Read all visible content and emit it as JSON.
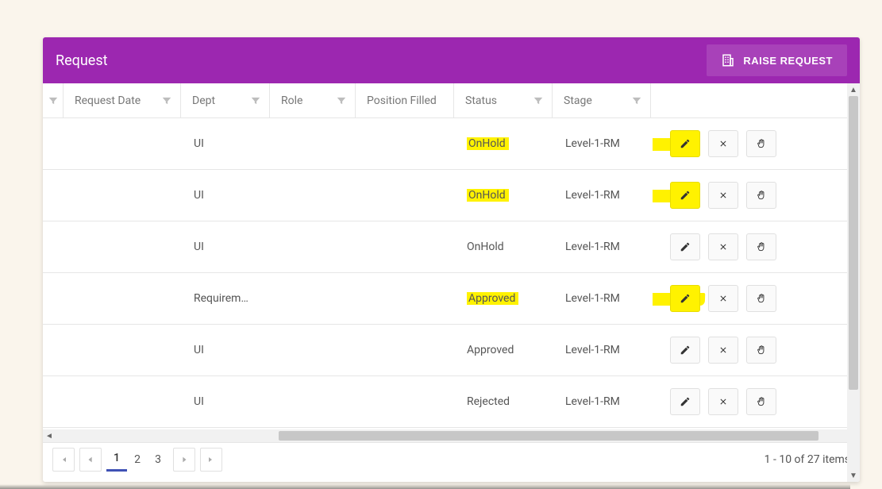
{
  "header": {
    "title": "Request",
    "raise_label": "RAISE REQUEST"
  },
  "columns": {
    "request_date": "Request Date",
    "dept": "Dept",
    "role": "Role",
    "position_filled": "Position Filled",
    "status": "Status",
    "stage": "Stage"
  },
  "rows": [
    {
      "request_date": "",
      "dept": "UI",
      "role": "",
      "position_filled": "",
      "status": "OnHold",
      "status_hl": true,
      "edit_hl": true,
      "stage": "Level-1-RM"
    },
    {
      "request_date": "",
      "dept": "UI",
      "role": "",
      "position_filled": "",
      "status": "OnHold",
      "status_hl": true,
      "edit_hl": true,
      "stage": "Level-1-RM"
    },
    {
      "request_date": "",
      "dept": "UI",
      "role": "",
      "position_filled": "",
      "status": "OnHold",
      "status_hl": false,
      "edit_hl": false,
      "stage": "Level-1-RM"
    },
    {
      "request_date": "",
      "dept": "Requirem…",
      "role": "",
      "position_filled": "",
      "status": "Approved",
      "status_hl": true,
      "edit_hl": true,
      "stage": "Level-1-RM"
    },
    {
      "request_date": "",
      "dept": "UI",
      "role": "",
      "position_filled": "",
      "status": "Approved",
      "status_hl": false,
      "edit_hl": false,
      "stage": "Level-1-RM"
    },
    {
      "request_date": "",
      "dept": "UI",
      "role": "",
      "position_filled": "",
      "status": "Rejected",
      "status_hl": false,
      "edit_hl": false,
      "stage": "Level-1-RM"
    }
  ],
  "pager": {
    "pages": [
      "1",
      "2",
      "3"
    ],
    "active_page_index": 0,
    "summary": "1 - 10 of 27 items"
  }
}
